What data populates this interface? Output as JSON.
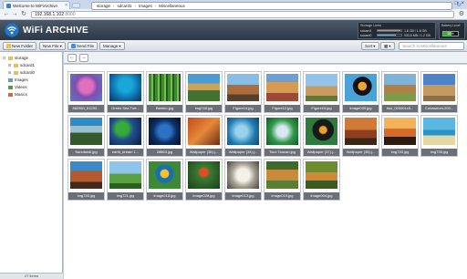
{
  "browser": {
    "tab_title": "Welcome to WiFiArchive",
    "tab_close": "×",
    "url_host": "192.168.1.102",
    "url_port": ":8000",
    "window_controls": [
      "–",
      "□",
      "×"
    ]
  },
  "header": {
    "logo_text": "WiFi ARCHIVE",
    "storage": {
      "title": "Storage Units",
      "units": [
        {
          "name": "sdcard1",
          "size": "1.8 GB / 1.8 GB",
          "used_fraction": 0.95
        },
        {
          "name": "sdcard0",
          "size": "933.8 MB / 1.2 GB",
          "used_fraction": 0.75
        }
      ]
    },
    "battery": {
      "title": "Battery Level",
      "percent_label": "58%",
      "level_fraction": 0.58
    }
  },
  "toolbar": {
    "new_folder": "New Folder",
    "new_file": "New File",
    "send_file": "Send File",
    "manage": "Manage",
    "sort": "Sort",
    "view": "▦",
    "search_placeholder": "Search in Miscellaneous"
  },
  "sidebar": {
    "root": "storage",
    "items": [
      {
        "label": "sdcard1"
      },
      {
        "label": "sdcard0"
      },
      {
        "label": "Images"
      },
      {
        "label": "Videos"
      },
      {
        "label": "Musics"
      }
    ],
    "status": "27 items"
  },
  "pathbar": {
    "crumbs": [
      "storage",
      "sdcard1",
      "Images",
      "Miscellaneous"
    ]
  },
  "files": [
    {
      "name": "882584_51252..."
    },
    {
      "name": "Green Sea Turt..."
    },
    {
      "name": "Bambo.jpg"
    },
    {
      "name": "img748.jpg"
    },
    {
      "name": "Figure14.jpg"
    },
    {
      "name": "Figure12.jpg"
    },
    {
      "name": "Figure15.jpg"
    },
    {
      "name": "image039.jpg"
    },
    {
      "name": "bsd_003401c5..."
    },
    {
      "name": "Colosseum-200..."
    },
    {
      "name": "Sandiandi.jpg"
    },
    {
      "name": "earth_dream 1..."
    },
    {
      "name": "28863.jpg"
    },
    {
      "name": "Wallpaper (36).j..."
    },
    {
      "name": "Wallpaper (34).j..."
    },
    {
      "name": "Toco Toucan.jpg"
    },
    {
      "name": "Wallpaper (37).j..."
    },
    {
      "name": "Wallpaper (35).j..."
    },
    {
      "name": "img730.jpg"
    },
    {
      "name": "img735.jpg"
    },
    {
      "name": "img730.jpg"
    },
    {
      "name": "img721.jpg"
    },
    {
      "name": "image018.jpg"
    },
    {
      "name": "image028.jpg"
    },
    {
      "name": "image013.jpg"
    },
    {
      "name": "image019.jpg"
    },
    {
      "name": "image004.jpg"
    }
  ]
}
